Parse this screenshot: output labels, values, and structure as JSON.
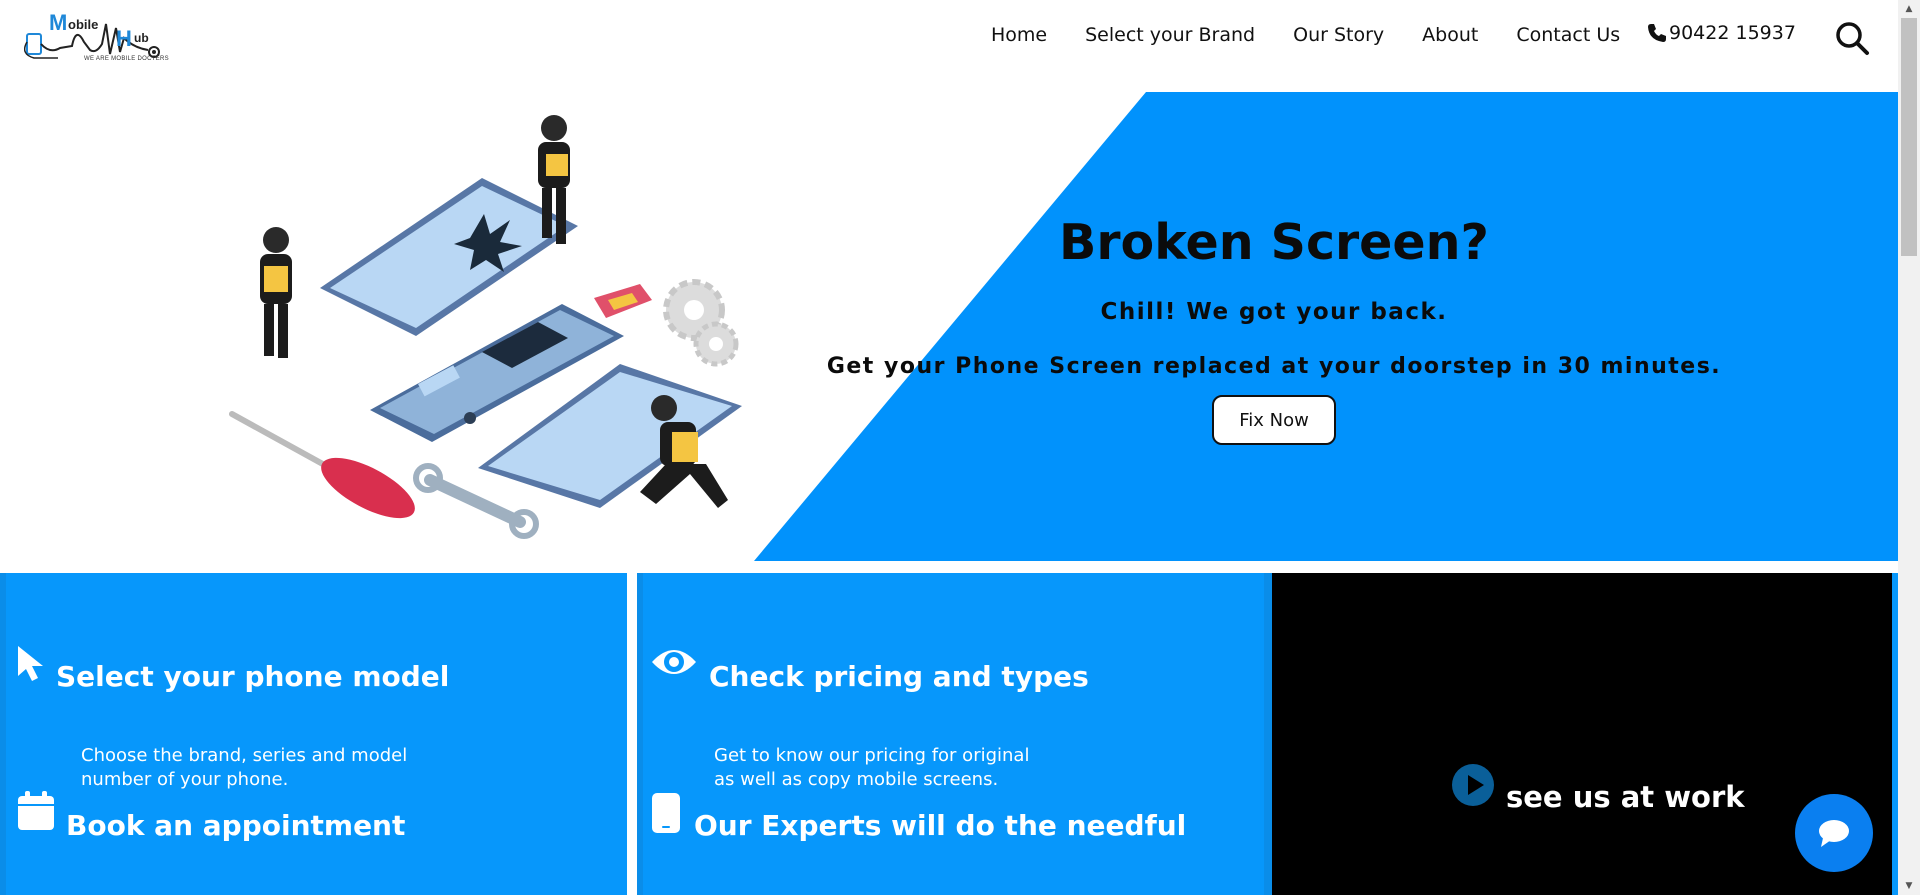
{
  "brand": {
    "logo_word_1_initial": "M",
    "logo_word_1_rest": "obile",
    "logo_word_2_initial": "H",
    "logo_word_2_rest": "ub",
    "tagline": "WE ARE MOBILE DOCTERS"
  },
  "nav": {
    "items": [
      {
        "label": "Home"
      },
      {
        "label": "Select your Brand"
      },
      {
        "label": "Our Story"
      },
      {
        "label": "About"
      },
      {
        "label": "Contact Us"
      }
    ],
    "phone": "90422 15937",
    "icons": {
      "phone": "phone-icon",
      "search": "search-icon"
    }
  },
  "hero": {
    "title": "Broken Screen?",
    "subtitle": "Chill! We got your back.",
    "description": "Get your Phone Screen replaced at your doorstep in 30 minutes.",
    "cta_label": "Fix Now",
    "accent_color": "#0192fc"
  },
  "features": {
    "items": [
      {
        "icon": "pointer-cursor-icon",
        "title": "Select your phone model",
        "text": "Choose the brand, series and model number of your phone."
      },
      {
        "icon": "eye-icon",
        "title": "Check pricing and types",
        "text": "Get to know our pricing for original as well as copy mobile screens."
      },
      {
        "icon": "calendar-icon",
        "title": "Book an appointment",
        "text": ""
      },
      {
        "icon": "mobile-phone-icon",
        "title": "Our Experts will do the needful",
        "text": ""
      }
    ],
    "background_color": "#0797fb"
  },
  "video": {
    "label": "see us at work",
    "icon": "play-circle-icon"
  },
  "chat": {
    "icon": "chat-bubble-icon",
    "color": "#0a7ff0"
  }
}
